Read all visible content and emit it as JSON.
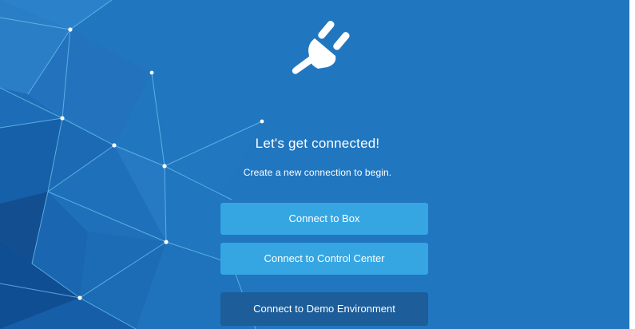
{
  "welcome": {
    "icon": "plug-icon",
    "headline": "Let's get connected!",
    "subtitle": "Create a new connection to begin."
  },
  "actions": {
    "connect_box": "Connect to Box",
    "connect_control_center": "Connect to Control Center",
    "connect_demo": "Connect to Demo Environment"
  },
  "colors": {
    "background": "#2176c0",
    "button_primary": "#36a6e3",
    "button_secondary": "#1c5d9a",
    "text": "#ffffff"
  }
}
